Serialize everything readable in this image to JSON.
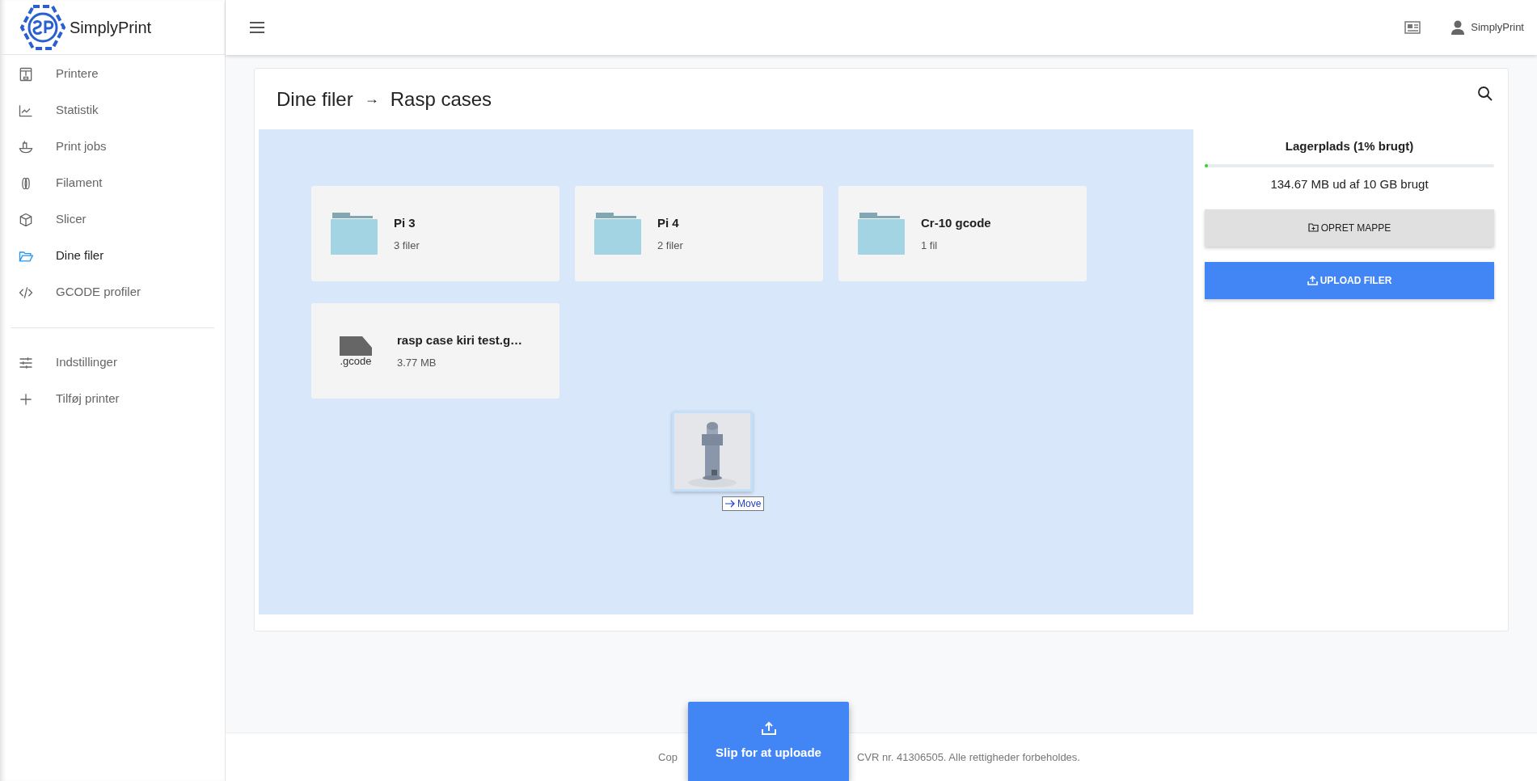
{
  "brand": "SimplyPrint",
  "sidebar": {
    "items": [
      {
        "label": "Printere",
        "selected": false
      },
      {
        "label": "Statistik",
        "selected": false
      },
      {
        "label": "Print jobs",
        "selected": false
      },
      {
        "label": "Filament",
        "selected": false
      },
      {
        "label": "Slicer",
        "selected": false
      },
      {
        "label": "Dine filer",
        "selected": true
      },
      {
        "label": "GCODE profiler",
        "selected": false
      }
    ],
    "secondary_items": [
      {
        "label": "Indstillinger",
        "selected": false
      },
      {
        "label": "Tilføj printer",
        "selected": false
      }
    ]
  },
  "header": {
    "user": "SimplyPrint"
  },
  "breadcrumb": {
    "items": [
      "Dine filer",
      "Rasp cases"
    ],
    "separator": "→"
  },
  "files": [
    {
      "kind": "folder",
      "name": "Pi 3",
      "meta": "3 filer"
    },
    {
      "kind": "folder",
      "name": "Pi 4",
      "meta": "2 filer"
    },
    {
      "kind": "folder",
      "name": "Cr-10 gcode",
      "meta": "1 fil"
    },
    {
      "kind": "file",
      "name": "rasp case kiri test.g…",
      "meta": "3.77 MB",
      "extension": ".gcode"
    }
  ],
  "storage": {
    "title": "Lagerplads (1% brugt)",
    "level": 0.01,
    "usage": "134.67 MB ud af 10 GB brugt"
  },
  "buttons": [
    {
      "kind": "secondary",
      "label": "OPRET MAPPE"
    },
    {
      "kind": "primary",
      "label": "UPLOAD FILER"
    }
  ],
  "drag": {
    "hint": "Move"
  },
  "drop_button": {
    "label": "Slip for at uploade"
  },
  "footer": {
    "left": "Cop",
    "right": "CVR nr. 41306505. Alle rettigheder forbeholdes."
  }
}
